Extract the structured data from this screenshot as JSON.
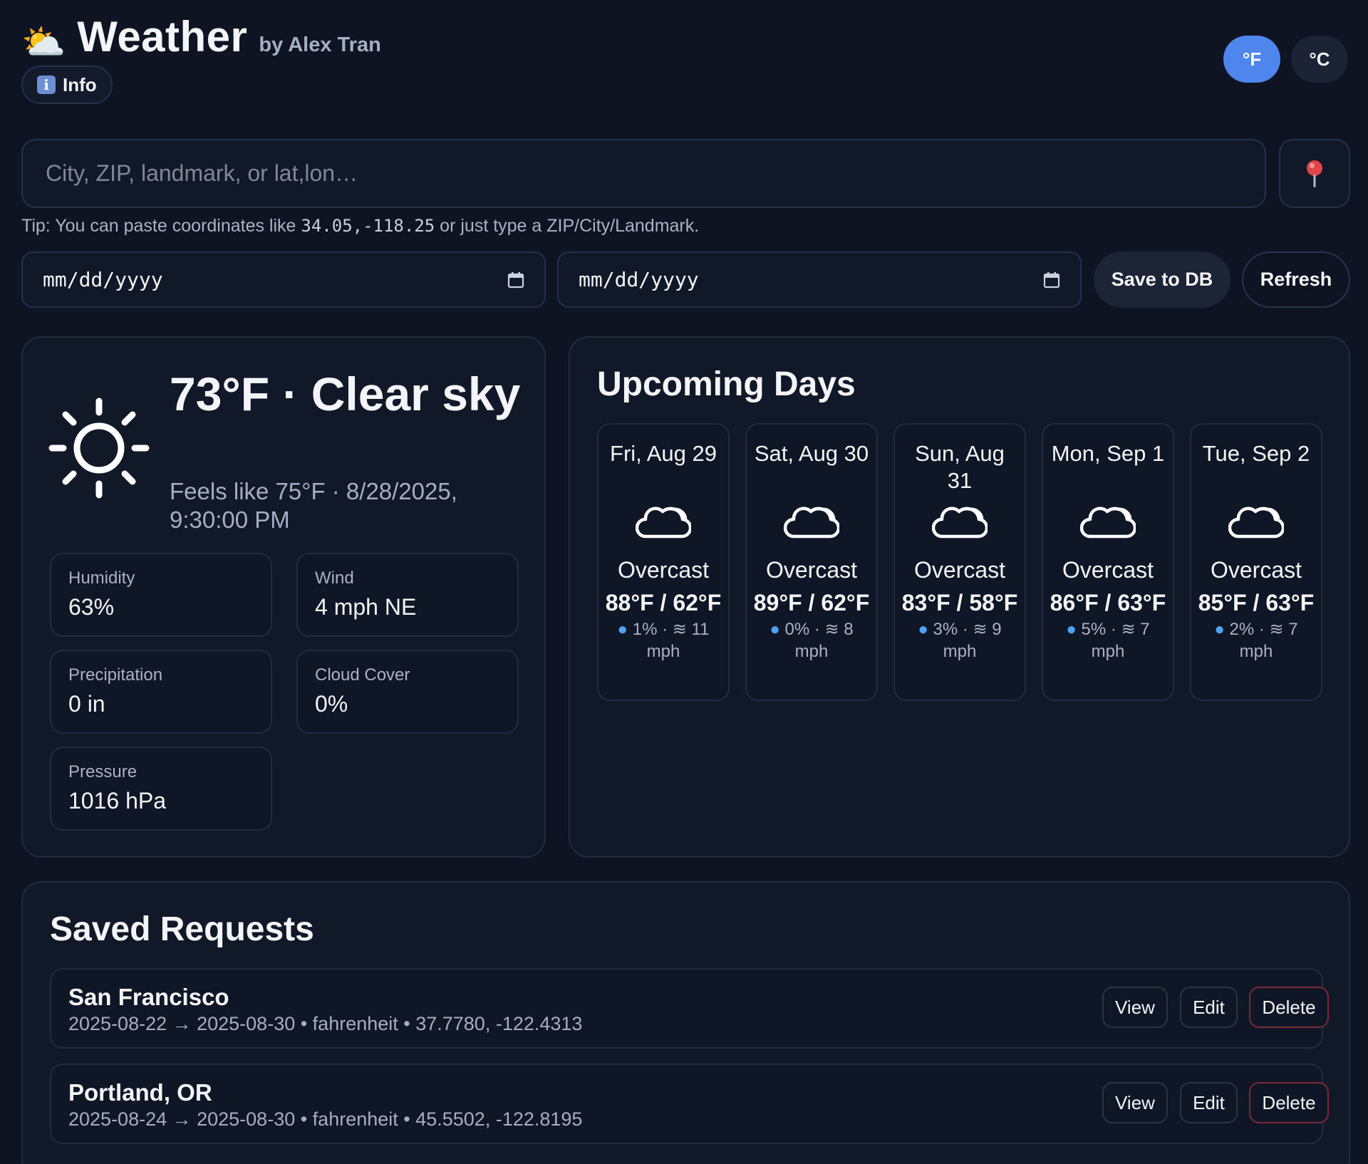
{
  "header": {
    "logo_icon": "sun-behind-cloud-icon",
    "logo_glyph": "⛅",
    "title": "Weather",
    "author": "by Alex Tran",
    "info_label": "Info"
  },
  "units": {
    "fahrenheit": "°F",
    "celsius": "°C",
    "active": "fahrenheit"
  },
  "search": {
    "placeholder": "City, ZIP, landmark, or lat,lon…",
    "value": "",
    "locate_icon": "pin-icon"
  },
  "tip": {
    "prefix": "Tip: You can paste coordinates like ",
    "example": "34.05,-118.25",
    "suffix": " or just type a ZIP/City/Landmark."
  },
  "dates": {
    "start_placeholder": "mm/dd/yyyy",
    "end_placeholder": "mm/dd/yyyy"
  },
  "actions": {
    "save": "Save to DB",
    "refresh": "Refresh"
  },
  "current": {
    "icon": "sun-icon",
    "headline": "73°F · Clear sky",
    "subline": "Feels like 75°F · 8/28/2025, 9:30:00 PM",
    "stats": [
      {
        "label": "Humidity",
        "value": "63%"
      },
      {
        "label": "Wind",
        "value": "4 mph NE"
      },
      {
        "label": "Precipitation",
        "value": "0 in"
      },
      {
        "label": "Cloud Cover",
        "value": "0%"
      },
      {
        "label": "Pressure",
        "value": "1016 hPa"
      }
    ]
  },
  "upcoming": {
    "title": "Upcoming Days",
    "days": [
      {
        "date": "Fri, Aug 29",
        "icon": "cloud-icon",
        "condition": "Overcast",
        "temps": "88°F / 62°F",
        "precip": "1%",
        "wind": "11 mph"
      },
      {
        "date": "Sat, Aug 30",
        "icon": "cloud-icon",
        "condition": "Overcast",
        "temps": "89°F / 62°F",
        "precip": "0%",
        "wind": "8 mph"
      },
      {
        "date": "Sun, Aug 31",
        "icon": "cloud-icon",
        "condition": "Overcast",
        "temps": "83°F / 58°F",
        "precip": "3%",
        "wind": "9 mph"
      },
      {
        "date": "Mon, Sep 1",
        "icon": "cloud-icon",
        "condition": "Overcast",
        "temps": "86°F / 63°F",
        "precip": "5%",
        "wind": "7 mph"
      },
      {
        "date": "Tue, Sep 2",
        "icon": "cloud-icon",
        "condition": "Overcast",
        "temps": "85°F / 63°F",
        "precip": "2%",
        "wind": "7 mph"
      }
    ]
  },
  "saved": {
    "title": "Saved Requests",
    "items": [
      {
        "name": "San Francisco",
        "meta": "2025-08-22 → 2025-08-30 • fahrenheit • 37.7780, -122.4313"
      },
      {
        "name": "Portland, OR",
        "meta": "2025-08-24 → 2025-08-30 • fahrenheit • 45.5502, -122.8195"
      }
    ],
    "view_label": "View",
    "edit_label": "Edit",
    "delete_label": "Delete"
  },
  "colors": {
    "background": "#0e1422",
    "panel": "#111828",
    "accent": "#4f86ee",
    "muted_text": "#a4afc3",
    "danger_border": "#7a2a34",
    "drop": "#4fa3f5"
  }
}
